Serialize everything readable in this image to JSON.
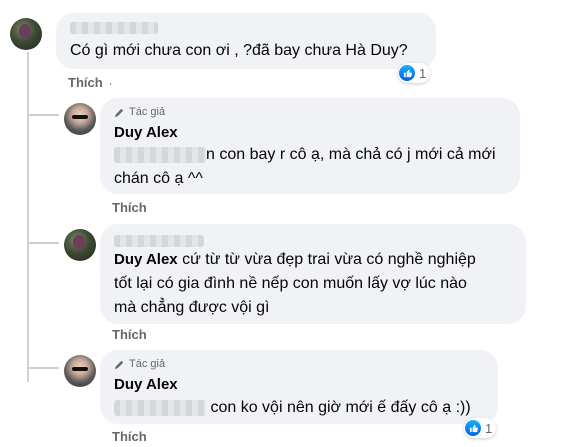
{
  "comments": [
    {
      "name": "",
      "text": "Có gì mới chưa con ơi , ?đã bay chưa Hà Duy?",
      "like_label": "Thích",
      "reaction_count": "1"
    },
    {
      "badge": "Tác giả",
      "name": "Duy Alex",
      "text_line1": "n con bay r cô ạ, mà chả có j mới cả mới",
      "text_line2": "chán cô ạ ^^",
      "like_label": "Thích"
    },
    {
      "name": "Duy Alex",
      "text_line1": "cứ từ từ vừa đẹp trai vừa có nghề nghiệp",
      "text_line2": "tốt lại có gia đình nề nếp con muốn lấy vợ lúc nào",
      "text_line3": "mà chẳng được vội gì",
      "like_label": "Thích"
    },
    {
      "badge": "Tác giả",
      "name": "Duy Alex",
      "text": "con ko vội nên giờ mới ế đấy cô ạ :))",
      "like_label": "Thích",
      "reaction_count": "1"
    }
  ],
  "colors": {
    "bubble": "#f0f2f5",
    "secondary_text": "#65676b",
    "like_blue": "#1877f2"
  }
}
